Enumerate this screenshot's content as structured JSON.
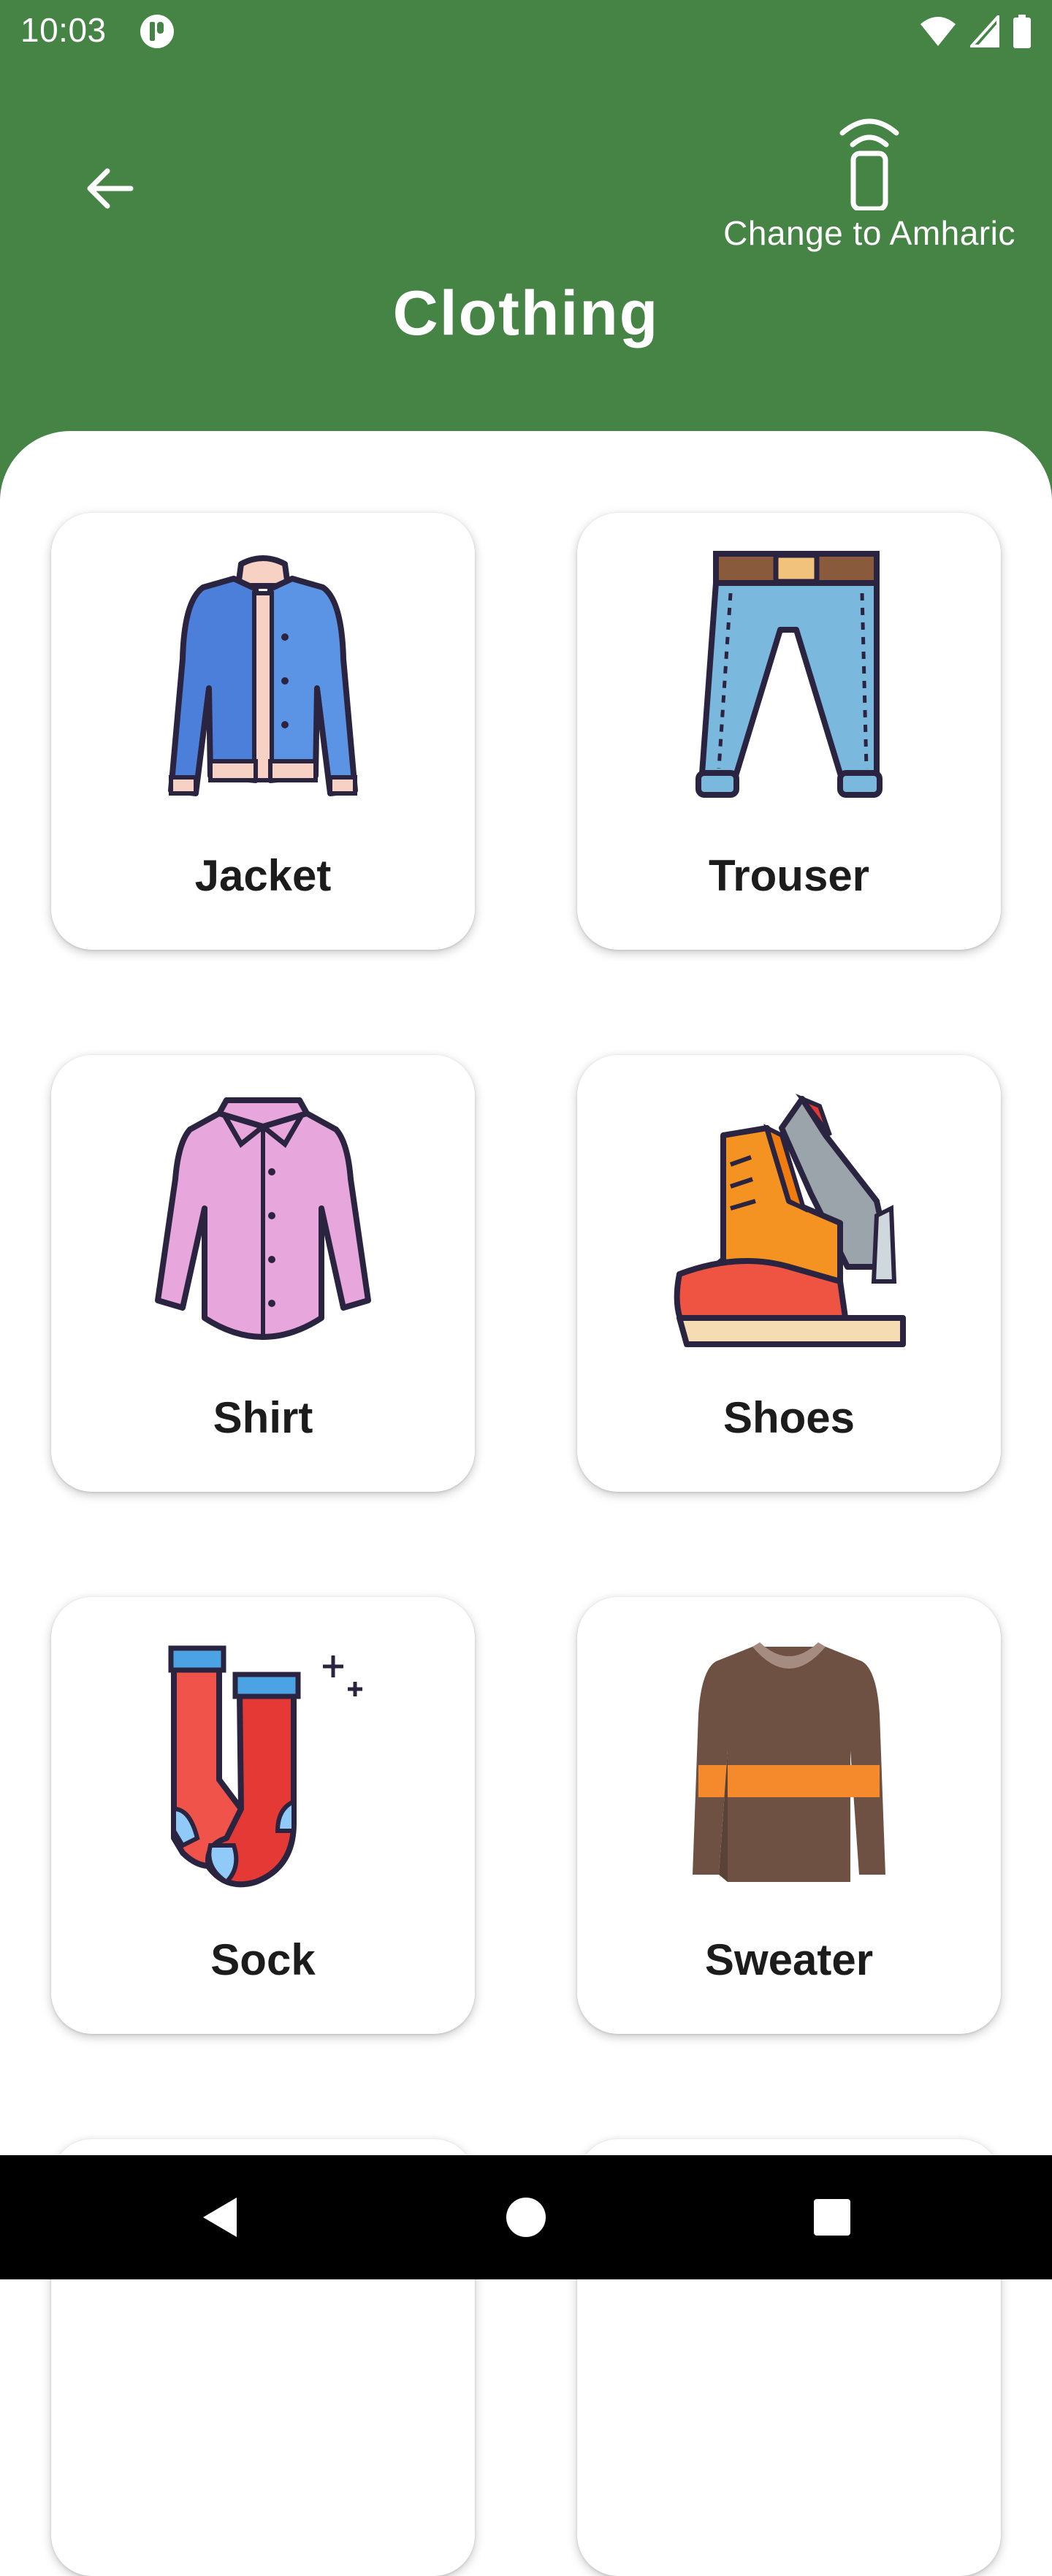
{
  "status_bar": {
    "time": "10:03"
  },
  "header": {
    "title": "Clothing",
    "lang_toggle_label": "Change to Amharic"
  },
  "items": [
    {
      "label": "Jacket",
      "icon": "jacket-icon"
    },
    {
      "label": "Trouser",
      "icon": "trouser-icon"
    },
    {
      "label": "Shirt",
      "icon": "shirt-icon"
    },
    {
      "label": "Shoes",
      "icon": "shoes-icon"
    },
    {
      "label": "Sock",
      "icon": "sock-icon"
    },
    {
      "label": "Sweater",
      "icon": "sweater-icon"
    }
  ],
  "colors": {
    "header_bg": "#468446",
    "card_bg": "#ffffff",
    "text": "#1c1c1c"
  }
}
